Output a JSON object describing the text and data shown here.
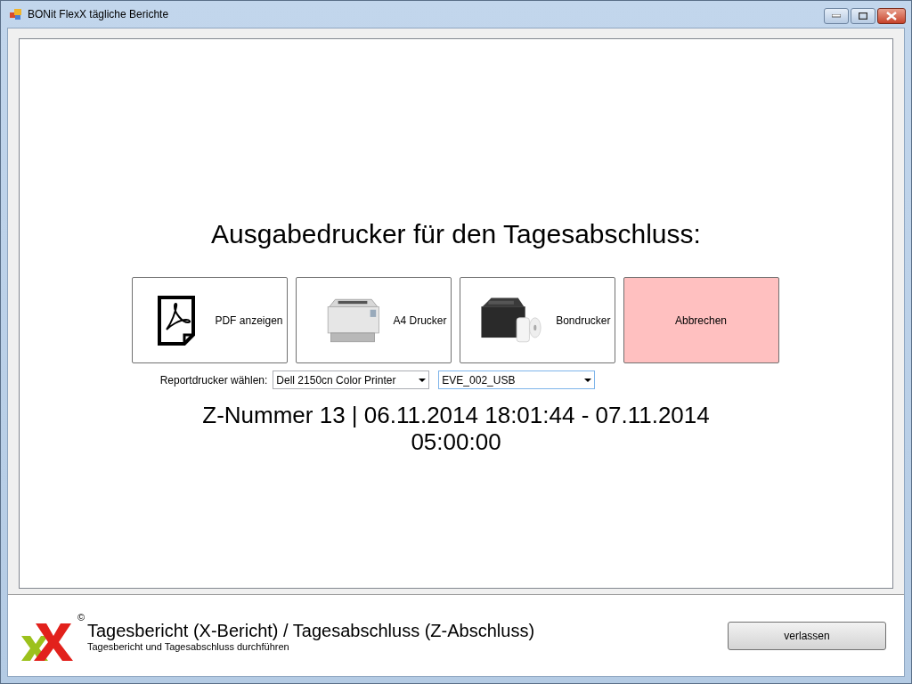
{
  "window": {
    "title": "BONit FlexX tägliche Berichte"
  },
  "heading": "Ausgabedrucker für den Tagesabschluss:",
  "buttons": [
    {
      "kind": "pdf",
      "label": "PDF anzeigen"
    },
    {
      "kind": "a4",
      "label": "A4 Drucker"
    },
    {
      "kind": "receipt",
      "label": "Bondrucker"
    },
    {
      "kind": "cancel",
      "label": "Abbrechen"
    }
  ],
  "printer_select": {
    "label": "Reportdrucker wählen:",
    "a4_value": "Dell 2150cn Color Printer",
    "receipt_value": "EVE_002_USB"
  },
  "z_info": "Z-Nummer 13 | 06.11.2014 18:01:44 - 07.11.2014 05:00:00",
  "footer": {
    "title": "Tagesbericht (X-Bericht) / Tagesabschluss (Z-Abschluss)",
    "subtitle": "Tagesbericht und Tagesabschluss durchführen",
    "copyright": "©",
    "exit_button": "verlassen"
  }
}
